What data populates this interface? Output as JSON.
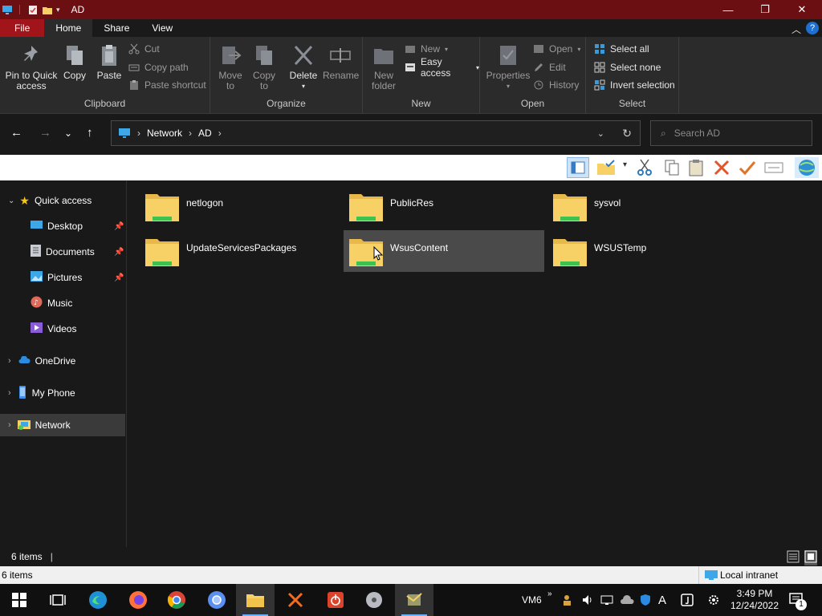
{
  "window": {
    "title": "AD"
  },
  "title_controls": {
    "minimize": "—",
    "maximize": "❐",
    "close": "✕"
  },
  "ribbon_tabs": [
    {
      "label": "File"
    },
    {
      "label": "Home"
    },
    {
      "label": "Share"
    },
    {
      "label": "View"
    }
  ],
  "ribbon": {
    "clipboard": {
      "label": "Clipboard",
      "pin": "Pin to Quick access",
      "copy": "Copy",
      "paste": "Paste",
      "cut": "Cut",
      "copy_path": "Copy path",
      "paste_shortcut": "Paste shortcut"
    },
    "organize": {
      "label": "Organize",
      "move_to": "Move to",
      "copy_to": "Copy to",
      "delete": "Delete",
      "rename": "Rename"
    },
    "new": {
      "label": "New",
      "new_folder": "New folder",
      "new_item": "New",
      "easy_access": "Easy access"
    },
    "open": {
      "label": "Open",
      "properties": "Properties",
      "open": "Open",
      "edit": "Edit",
      "history": "History"
    },
    "select": {
      "label": "Select",
      "select_all": "Select all",
      "select_none": "Select none",
      "invert": "Invert selection"
    }
  },
  "address": {
    "crumbs": [
      "Network",
      "AD"
    ],
    "search_placeholder": "Search AD"
  },
  "nav": {
    "quick_access": "Quick access",
    "items": [
      {
        "label": "Desktop",
        "pinned": true
      },
      {
        "label": "Documents",
        "pinned": true
      },
      {
        "label": "Pictures",
        "pinned": true
      },
      {
        "label": "Music",
        "pinned": false
      },
      {
        "label": "Videos",
        "pinned": false
      }
    ],
    "onedrive": "OneDrive",
    "myphone": "My Phone",
    "network": "Network"
  },
  "folders": [
    {
      "name": "netlogon"
    },
    {
      "name": "PublicRes"
    },
    {
      "name": "sysvol"
    },
    {
      "name": "UpdateServicesPackages"
    },
    {
      "name": "WsusContent"
    },
    {
      "name": "WSUSTemp"
    }
  ],
  "status": {
    "count": "6 items"
  },
  "ie_status": {
    "left": "6 items",
    "zone": "Local intranet"
  },
  "taskbar": {
    "vm_label": "VM6",
    "time": "3:49 PM",
    "date": "12/24/2022",
    "notification_count": "1"
  },
  "colors": {
    "title_bar": "#6b0f12",
    "file_tab": "#a0141a",
    "folder_yellow": "#f7d166",
    "network_accent": "#3cc6ff"
  }
}
